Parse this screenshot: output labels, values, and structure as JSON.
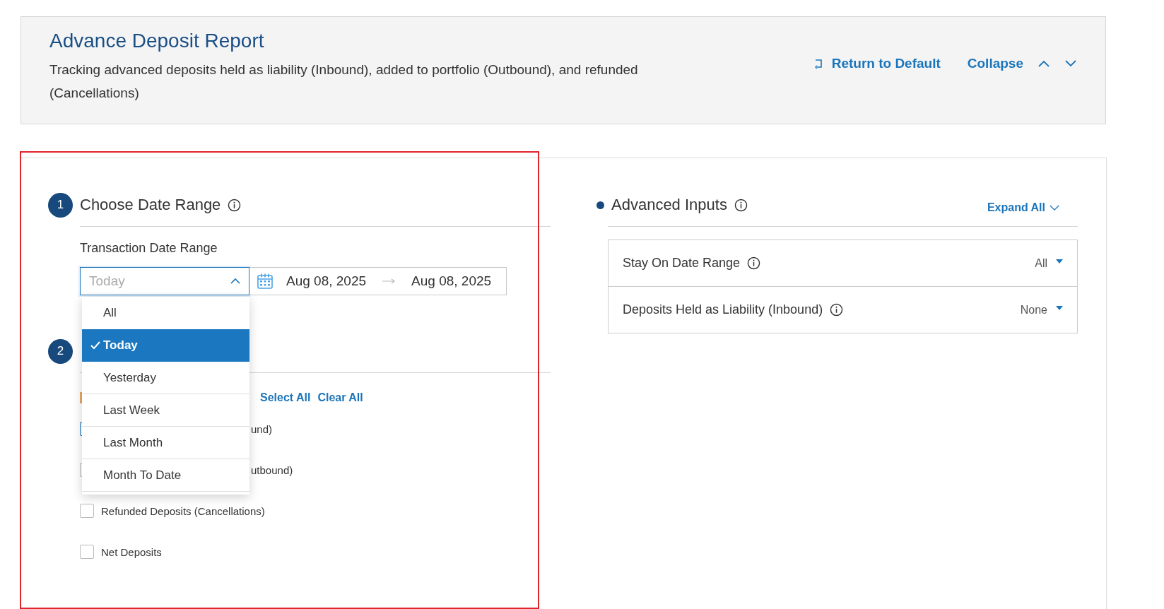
{
  "header": {
    "title": "Advance Deposit Report",
    "description": "Tracking advanced deposits held as liability (Inbound), added to portfolio (Outbound), and refunded (Cancellations)",
    "actions": [
      {
        "kind": "reset",
        "label": "Return to Default"
      },
      {
        "kind": "collapse",
        "label": "Collapse"
      }
    ]
  },
  "date_section": {
    "step": "1",
    "title": "Choose Date Range",
    "field_label": "Transaction Date Range",
    "select": {
      "value": "Today",
      "expanded": true
    },
    "start_date": "Aug 08, 2025",
    "end_date": "Aug 08, 2025",
    "options": [
      {
        "label": "All",
        "selected": false
      },
      {
        "label": "Today",
        "selected": true
      },
      {
        "label": "Yesterday",
        "selected": false
      },
      {
        "label": "Last Week",
        "selected": false
      },
      {
        "label": "Last Month",
        "selected": false
      },
      {
        "label": "Month To Date",
        "selected": false
      }
    ]
  },
  "step_section": {
    "step": "2",
    "links": [
      "Select All",
      "Clear All"
    ],
    "items": [
      {
        "label": "und)",
        "partial": true,
        "checked": false
      },
      {
        "label": "utbound)",
        "partial": true,
        "checked": false
      },
      {
        "label": "Refunded Deposits (Cancellations)",
        "checked": false
      },
      {
        "label": "Net Deposits",
        "checked": false
      }
    ]
  },
  "advanced": {
    "title": "Advanced Inputs",
    "expand_label": "Expand All",
    "rows": [
      {
        "label": "Stay On Date Range",
        "value": "All"
      },
      {
        "label": "Deposits Held as Liability (Inbound)",
        "value": "None"
      }
    ]
  }
}
